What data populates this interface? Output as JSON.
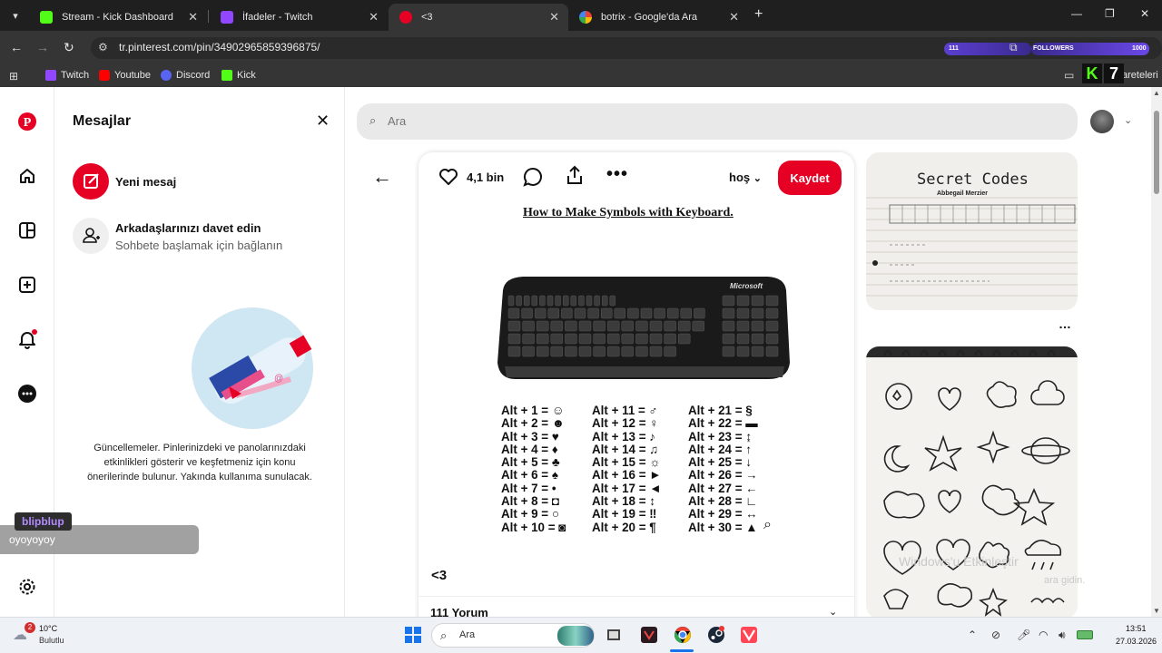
{
  "browser": {
    "tabs": [
      {
        "label": "Stream - Kick Dashboard",
        "active": false,
        "favicon": "kick-logo"
      },
      {
        "label": "İfadeler - Twitch",
        "active": false,
        "favicon": "twitch-logo"
      },
      {
        "label": "<3",
        "active": true,
        "favicon": "pinterest-logo"
      },
      {
        "label": "botrix - Google'da Ara",
        "active": false,
        "favicon": "google-logo"
      }
    ],
    "url": "tr.pinterest.com/pin/34902965859396875/",
    "bookmarks": [
      {
        "label": "Twitch",
        "icon": "twitch-logo"
      },
      {
        "label": "Youtube",
        "icon": "youtube-logo"
      },
      {
        "label": "Discord",
        "icon": "discord-logo"
      },
      {
        "label": "Kick",
        "icon": "kick-logo"
      }
    ],
    "bookmarks_overflow": "areteleri",
    "overlay_viewers": "111",
    "overlay_followers": "FOLLOWERS",
    "overlay_count": "1000",
    "kick_badge": [
      "K",
      "7"
    ]
  },
  "messages_panel": {
    "title": "Mesajlar",
    "new_message": "Yeni mesaj",
    "invite_title": "Arkadaşlarınızı davet edin",
    "invite_subtitle": "Sohbete başlamak için bağlanın",
    "description": "Güncellemeler. Pinlerinizdeki ve panolarınızdaki etkinlikleri gösterir ve keşfetmeniz için konu önerilerinde bulunur. Yakında kullanıma sunulacak."
  },
  "search": {
    "placeholder": "Ara"
  },
  "pin": {
    "like_count": "4,1 bin",
    "board": "hoş",
    "save_label": "Kaydet",
    "headline": "How to Make Symbols with Keyboard.",
    "keyboard_brand": "Microsoft",
    "alt_codes": [
      [
        "Alt + 1 = ☺",
        "Alt + 2 = ☻",
        "Alt + 3 = ♥",
        "Alt + 4 = ♦",
        "Alt + 5 = ♣",
        "Alt + 6 = ♠",
        "Alt + 7 = •",
        "Alt + 8 = ◘",
        "Alt + 9 = ○",
        "Alt + 10 = ◙"
      ],
      [
        "Alt + 11 = ♂",
        "Alt + 12 = ♀",
        "Alt + 13 = ♪",
        "Alt + 14 = ♫",
        "Alt + 15 = ☼",
        "Alt + 16 = ►",
        "Alt + 17 = ◄",
        "Alt + 18 = ↕",
        "Alt + 19 = ‼",
        "Alt + 20 = ¶"
      ],
      [
        "Alt + 21 = §",
        "Alt + 22 = ▬",
        "Alt + 23 = ↨",
        "Alt + 24 = ↑",
        "Alt + 25 = ↓",
        "Alt + 26 = →",
        "Alt + 27 = ←",
        "Alt + 28 = ∟",
        "Alt + 29 = ↔",
        "Alt + 30 = ▲"
      ]
    ],
    "title": "<3",
    "comments": "111 Yorum"
  },
  "related": {
    "thumb1_title": "Secret Codes",
    "thumb1_author": "Abbegail Merzier"
  },
  "windows_watermark": "Windows'u Etkinleştir",
  "windows_watermark2": "ara gidin.",
  "stream_overlay": {
    "user": "blipblup",
    "message": "oyoyoyoy"
  },
  "taskbar": {
    "weather_temp": "10°C",
    "weather_desc": "Bulutlu",
    "weather_badge": "2",
    "search_label": "Ara",
    "time": "13:51",
    "date": "27.03.2026"
  },
  "colors": {
    "pinterest_red": "#e60023",
    "kick_green": "#53fc18",
    "twitch_purple": "#9146ff"
  }
}
